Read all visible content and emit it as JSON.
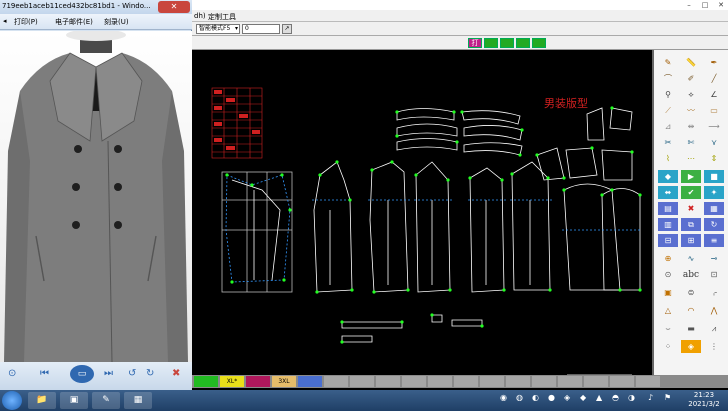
{
  "cad": {
    "menu": {
      "item_dh": "dh)",
      "item_custom": "定制工具"
    },
    "toolbar": {
      "mode_value": "智能模式F5",
      "number_value": "0",
      "print_label": "打"
    },
    "canvas": {
      "title": "男装版型"
    },
    "right_panel": {
      "abc_label": "abc"
    },
    "palette": [
      {
        "label": "",
        "color": "#22bb22"
      },
      {
        "label": "XL*",
        "color": "#eadf1a"
      },
      {
        "label": "",
        "color": "#b0185c"
      },
      {
        "label": "3XL",
        "color": "#e6bd6a"
      },
      {
        "label": "",
        "color": "#4a6fd0"
      },
      {
        "label": "",
        "color": "#a6a6a6"
      },
      {
        "label": "",
        "color": "#a6a6a6"
      },
      {
        "label": "",
        "color": "#a6a6a6"
      },
      {
        "label": "",
        "color": "#a6a6a6"
      },
      {
        "label": "",
        "color": "#a6a6a6"
      },
      {
        "label": "",
        "color": "#a6a6a6"
      },
      {
        "label": "",
        "color": "#a6a6a6"
      },
      {
        "label": "",
        "color": "#a6a6a6"
      },
      {
        "label": "",
        "color": "#a6a6a6"
      },
      {
        "label": "",
        "color": "#a6a6a6"
      },
      {
        "label": "",
        "color": "#a6a6a6"
      },
      {
        "label": "",
        "color": "#a6a6a6"
      },
      {
        "label": "",
        "color": "#a6a6a6"
      }
    ]
  },
  "viewer": {
    "title": "719eeb1aceb11ced432bc81bd1 - Windo...",
    "menu": {
      "print": "打印(P)",
      "email": "电子邮件(E)",
      "burn": "刻录(U)"
    }
  },
  "taskbar": {
    "time": "21:23",
    "date": "2021/3/2"
  }
}
